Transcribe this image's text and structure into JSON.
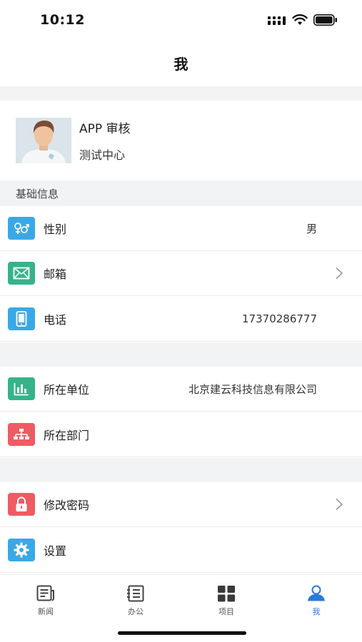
{
  "status_bar": {
    "time": "10:12"
  },
  "nav": {
    "title": "我"
  },
  "profile": {
    "name": "APP 审核",
    "org": "测试中心"
  },
  "section_basic": {
    "title": "基础信息"
  },
  "rows": {
    "gender": {
      "label": "性别",
      "value": "男",
      "icon": "gender-icon",
      "color": "#3aa8e6"
    },
    "email": {
      "label": "邮箱",
      "value": "",
      "icon": "mail-icon",
      "color": "#36b38a"
    },
    "phone": {
      "label": "电话",
      "value": "17370286777",
      "icon": "phone-icon",
      "color": "#3aa8e6"
    },
    "company": {
      "label": "所在单位",
      "value": "北京建云科技信息有限公司",
      "icon": "building-chart-icon",
      "color": "#36b38a"
    },
    "department": {
      "label": "所在部门",
      "value": "",
      "icon": "org-chart-icon",
      "color": "#ef5b63"
    },
    "password": {
      "label": "修改密码",
      "value": "",
      "icon": "lock-icon",
      "color": "#ef5b63"
    },
    "settings": {
      "label": "设置",
      "value": "",
      "icon": "gear-icon",
      "color": "#3aa8e6"
    }
  },
  "tabs": [
    {
      "label": "新闻",
      "icon": "news-icon",
      "active": false
    },
    {
      "label": "办公",
      "icon": "office-list-icon",
      "active": false
    },
    {
      "label": "项目",
      "icon": "grid-icon",
      "active": false
    },
    {
      "label": "我",
      "icon": "user-icon",
      "active": true
    }
  ],
  "colors": {
    "accent": "#2a7ad9",
    "separator": "#f2f3f5"
  }
}
